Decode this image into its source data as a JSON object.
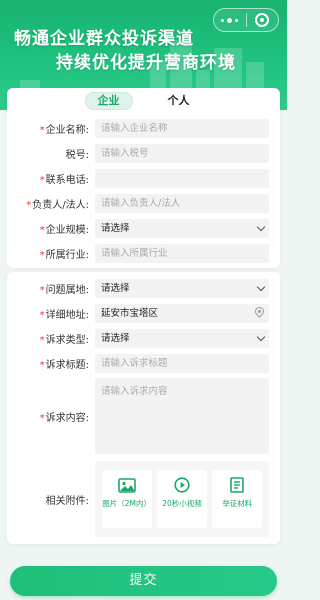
{
  "header": {
    "slogan_line1": "畅通企业群众投诉渠道",
    "slogan_line2": "持续优化提升营商环境"
  },
  "tabs": [
    {
      "label": "企业",
      "active": true
    },
    {
      "label": "个人",
      "active": false
    }
  ],
  "section1": {
    "fields": [
      {
        "label": "企业名称:",
        "required": true,
        "placeholder": "请输入企业名称",
        "kind": "input"
      },
      {
        "label": "税号:",
        "required": false,
        "placeholder": "请输入税号",
        "kind": "input"
      },
      {
        "label": "联系电话:",
        "required": true,
        "placeholder": "",
        "kind": "input"
      },
      {
        "label": "负责人/法人:",
        "required": true,
        "placeholder": "请输入负责人/法人",
        "kind": "input"
      },
      {
        "label": "企业规模:",
        "required": true,
        "value": "请选择",
        "kind": "select"
      },
      {
        "label": "所属行业:",
        "required": true,
        "placeholder": "请输入所属行业",
        "kind": "input"
      }
    ]
  },
  "section2": {
    "fields": [
      {
        "label": "问题属地:",
        "required": true,
        "value": "请选择",
        "kind": "select"
      },
      {
        "label": "详细地址:",
        "required": true,
        "value": "延安市宝塔区",
        "kind": "location"
      },
      {
        "label": "诉求类型:",
        "required": true,
        "value": "请选择",
        "kind": "select"
      },
      {
        "label": "诉求标题:",
        "required": true,
        "placeholder": "请输入诉求标题",
        "kind": "input"
      }
    ],
    "content": {
      "label": "诉求内容:",
      "required": true,
      "placeholder": "请输入诉求内容"
    },
    "attachments": {
      "label": "相关附件:",
      "items": [
        {
          "caption": "图片（2M内）",
          "icon": "image-icon"
        },
        {
          "caption": "20秒小视频",
          "icon": "video-icon"
        },
        {
          "caption": "举证材料",
          "icon": "document-icon"
        }
      ]
    }
  },
  "submit_label": "提交",
  "colors": {
    "brand": "#1fbf79",
    "required": "#e23a3a"
  }
}
